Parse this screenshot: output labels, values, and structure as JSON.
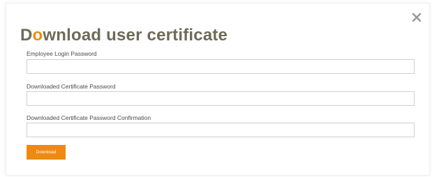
{
  "dialog": {
    "title_first_letter": "D",
    "title_accent_letter": "o",
    "title_rest": "wnload user certificate",
    "close_icon": "close-icon",
    "accent_color": "#e8900f",
    "title_color": "#6d6b57"
  },
  "form": {
    "fields": [
      {
        "label": "Employee Login Password",
        "value": "",
        "type": "password"
      },
      {
        "label": "Downloaded Certificate Password",
        "value": "",
        "type": "password"
      },
      {
        "label": "Downloaded Certificate Password Confirmation",
        "value": "",
        "type": "password"
      }
    ],
    "submit_label": "Download",
    "submit_color": "#ee8a0f"
  }
}
